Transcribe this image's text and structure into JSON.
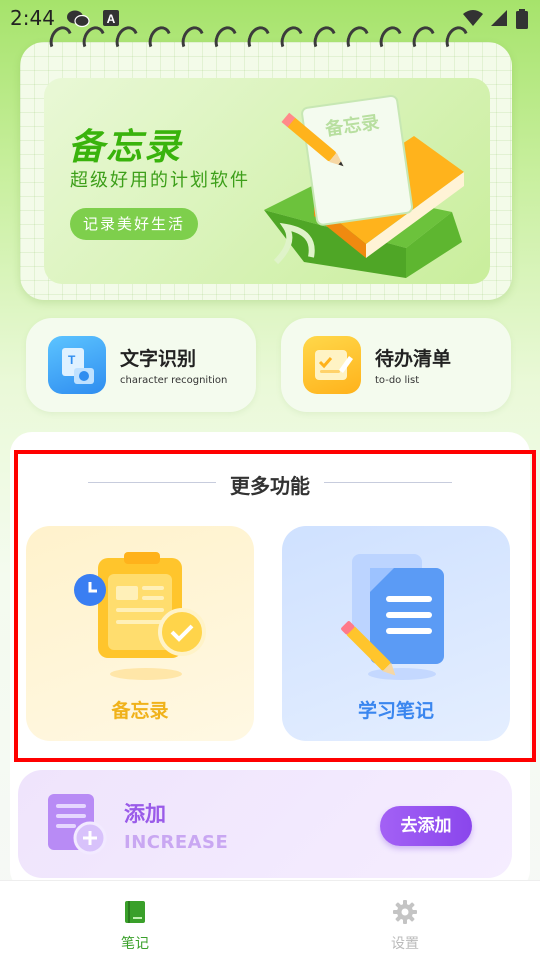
{
  "status_bar": {
    "time": "2:44"
  },
  "banner": {
    "title": "备忘录",
    "subtitle": "超级好用的计划软件",
    "pill": "记录美好生活",
    "paper_label": "备忘录"
  },
  "features": [
    {
      "title": "文字识别",
      "subtitle": "character recognition",
      "icon": "text-recognition-icon"
    },
    {
      "title": "待办清单",
      "subtitle": "to-do list",
      "icon": "todo-list-icon"
    }
  ],
  "more": {
    "title": "更多功能",
    "items": [
      {
        "label": "备忘录",
        "icon": "memo-clipboard-icon"
      },
      {
        "label": "学习笔记",
        "icon": "study-notes-icon"
      }
    ]
  },
  "add": {
    "title": "添加",
    "subtitle": "INCREASE",
    "button": "去添加"
  },
  "nav": [
    {
      "label": "笔记",
      "icon": "notebook-icon",
      "active": true
    },
    {
      "label": "设置",
      "icon": "gear-icon",
      "active": false
    }
  ],
  "colors": {
    "accent_green": "#39b30c",
    "memo_yellow": "#f0b21b",
    "notes_blue": "#3a86ef",
    "add_purple": "#9a5be9",
    "nav_active": "#3aa02a",
    "nav_inactive": "#bbbbbb"
  }
}
